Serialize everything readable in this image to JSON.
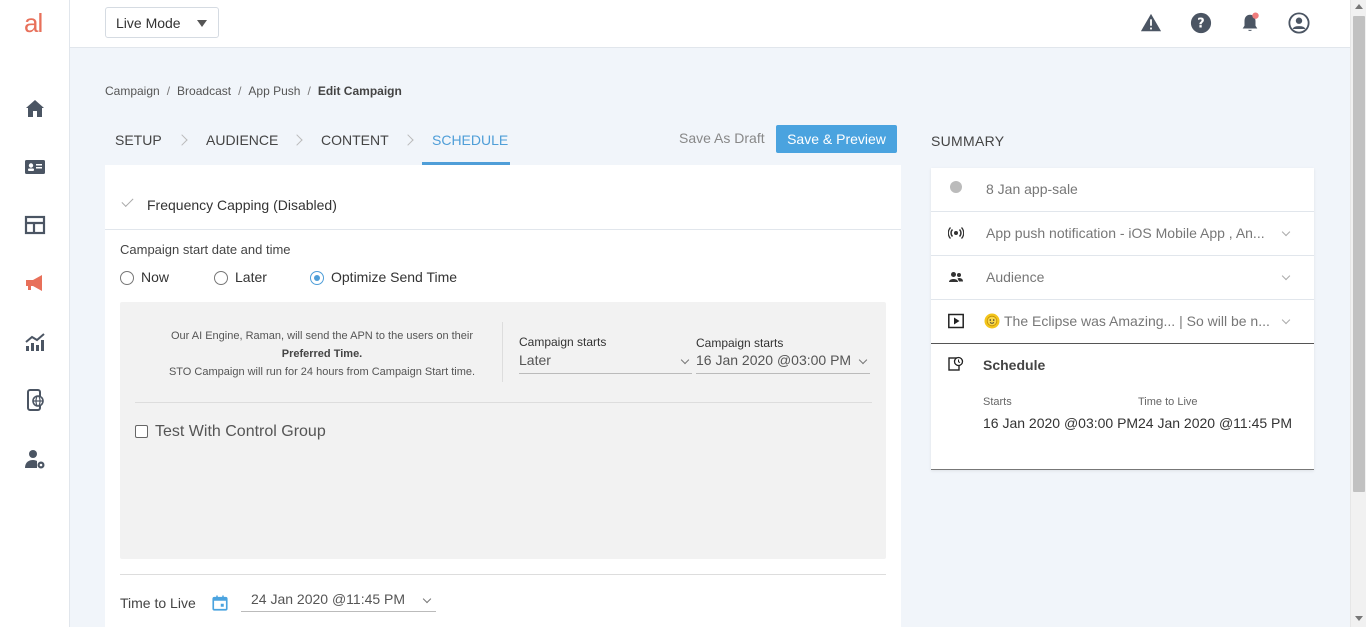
{
  "app": {
    "logo_text": "al",
    "mode": "Live Mode",
    "colors": {
      "accent": "#4f9ed8",
      "brand": "#e8705a",
      "button": "#4aa3df"
    }
  },
  "sidebar": {
    "items": [
      {
        "name": "home",
        "icon": "home-icon"
      },
      {
        "name": "contacts",
        "icon": "contact-card-icon"
      },
      {
        "name": "layout",
        "icon": "layout-icon"
      },
      {
        "name": "campaigns",
        "icon": "megaphone-icon",
        "active": true
      },
      {
        "name": "analytics",
        "icon": "trend-chart-icon"
      },
      {
        "name": "mobile",
        "icon": "mobile-globe-icon"
      },
      {
        "name": "user-settings",
        "icon": "user-gear-icon"
      }
    ]
  },
  "topbar": {
    "icons": [
      "warning-icon",
      "help-icon",
      "bell-icon",
      "account-icon"
    ]
  },
  "breadcrumb": [
    "Campaign",
    "Broadcast",
    "App Push",
    "Edit Campaign"
  ],
  "steps": [
    "SETUP",
    "AUDIENCE",
    "CONTENT",
    "SCHEDULE"
  ],
  "actions": {
    "draft": "Save As Draft",
    "preview": "Save & Preview"
  },
  "frequency": {
    "label": "Frequency Capping (Disabled)"
  },
  "start": {
    "label": "Campaign start date and time",
    "options": [
      "Now",
      "Later",
      "Optimize Send Time"
    ],
    "selected": "Optimize Send Time"
  },
  "sto": {
    "line1": "Our AI Engine, Raman, will send the APN to the users on their",
    "line2": "Preferred Time.",
    "line3": "STO Campaign will run for 24 hours from Campaign Start time.",
    "field1_label": "Campaign starts",
    "field1_value": "Later",
    "field2_label": "Campaign starts",
    "field2_value": "16 Jan 2020 @03:00 PM",
    "control_label": "Test With Control Group"
  },
  "ttl": {
    "label": "Time to Live",
    "value": "24 Jan 2020 @11:45 PM"
  },
  "summary": {
    "title": "SUMMARY",
    "rows": [
      "8 Jan app-sale",
      "App push notification - iOS Mobile App , An...",
      "Audience",
      "The Eclipse was Amazing... | So will be n..."
    ],
    "schedule_title": "Schedule",
    "starts_label": "Starts",
    "starts_value": "16 Jan 2020 @03:00 PM",
    "ttl_label": "Time to Live",
    "ttl_value": "24 Jan 2020 @11:45 PM"
  }
}
